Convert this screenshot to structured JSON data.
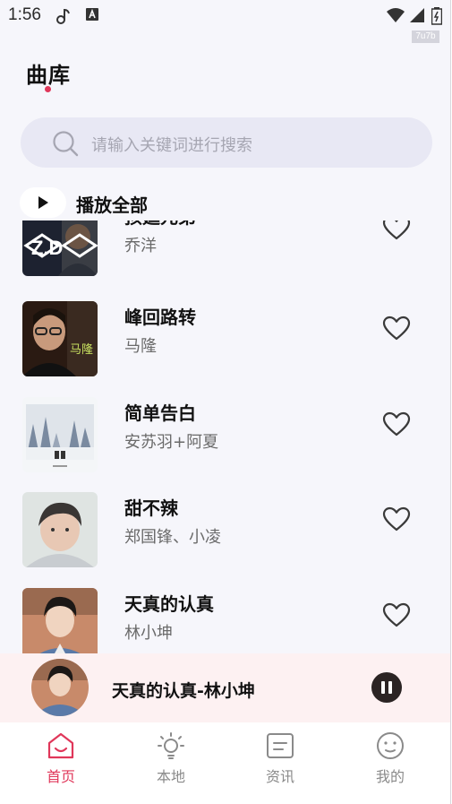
{
  "status_bar": {
    "time": "1:56",
    "tag": "7u7b"
  },
  "header": {
    "title": "曲库"
  },
  "search": {
    "placeholder": "请输入关键词进行搜索"
  },
  "play_all": {
    "label": "播放全部"
  },
  "songs": [
    {
      "title": "孩莛元弟",
      "artist": "乔洋"
    },
    {
      "title": "峰回路转",
      "artist": "马隆"
    },
    {
      "title": "简单告白",
      "artist": "安苏羽+阿夏"
    },
    {
      "title": "甜不辣",
      "artist": "郑国锋、小凌"
    },
    {
      "title": "天真的认真",
      "artist": "林小坤"
    }
  ],
  "mini_player": {
    "now_playing": "天真的认真-林小坤"
  },
  "tabs": [
    {
      "label": "首页",
      "icon": "home-icon",
      "active": true
    },
    {
      "label": "本地",
      "icon": "bulb-icon",
      "active": false
    },
    {
      "label": "资讯",
      "icon": "news-icon",
      "active": false
    },
    {
      "label": "我的",
      "icon": "face-icon",
      "active": false
    }
  ],
  "colors": {
    "accent": "#e0375a",
    "background": "#f6f6fb",
    "search_bg": "#e8e8f4",
    "mini_player_bg": "#fdf1f2"
  }
}
